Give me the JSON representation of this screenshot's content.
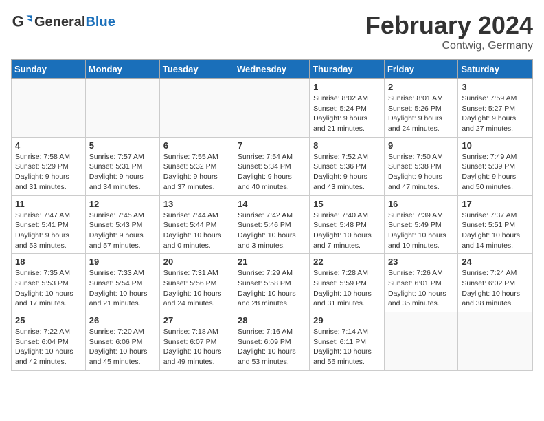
{
  "header": {
    "logo_general": "General",
    "logo_blue": "Blue",
    "month": "February 2024",
    "location": "Contwig, Germany"
  },
  "days_of_week": [
    "Sunday",
    "Monday",
    "Tuesday",
    "Wednesday",
    "Thursday",
    "Friday",
    "Saturday"
  ],
  "weeks": [
    [
      {
        "day": "",
        "content": ""
      },
      {
        "day": "",
        "content": ""
      },
      {
        "day": "",
        "content": ""
      },
      {
        "day": "",
        "content": ""
      },
      {
        "day": "1",
        "content": "Sunrise: 8:02 AM\nSunset: 5:24 PM\nDaylight: 9 hours\nand 21 minutes."
      },
      {
        "day": "2",
        "content": "Sunrise: 8:01 AM\nSunset: 5:26 PM\nDaylight: 9 hours\nand 24 minutes."
      },
      {
        "day": "3",
        "content": "Sunrise: 7:59 AM\nSunset: 5:27 PM\nDaylight: 9 hours\nand 27 minutes."
      }
    ],
    [
      {
        "day": "4",
        "content": "Sunrise: 7:58 AM\nSunset: 5:29 PM\nDaylight: 9 hours\nand 31 minutes."
      },
      {
        "day": "5",
        "content": "Sunrise: 7:57 AM\nSunset: 5:31 PM\nDaylight: 9 hours\nand 34 minutes."
      },
      {
        "day": "6",
        "content": "Sunrise: 7:55 AM\nSunset: 5:32 PM\nDaylight: 9 hours\nand 37 minutes."
      },
      {
        "day": "7",
        "content": "Sunrise: 7:54 AM\nSunset: 5:34 PM\nDaylight: 9 hours\nand 40 minutes."
      },
      {
        "day": "8",
        "content": "Sunrise: 7:52 AM\nSunset: 5:36 PM\nDaylight: 9 hours\nand 43 minutes."
      },
      {
        "day": "9",
        "content": "Sunrise: 7:50 AM\nSunset: 5:38 PM\nDaylight: 9 hours\nand 47 minutes."
      },
      {
        "day": "10",
        "content": "Sunrise: 7:49 AM\nSunset: 5:39 PM\nDaylight: 9 hours\nand 50 minutes."
      }
    ],
    [
      {
        "day": "11",
        "content": "Sunrise: 7:47 AM\nSunset: 5:41 PM\nDaylight: 9 hours\nand 53 minutes."
      },
      {
        "day": "12",
        "content": "Sunrise: 7:45 AM\nSunset: 5:43 PM\nDaylight: 9 hours\nand 57 minutes."
      },
      {
        "day": "13",
        "content": "Sunrise: 7:44 AM\nSunset: 5:44 PM\nDaylight: 10 hours\nand 0 minutes."
      },
      {
        "day": "14",
        "content": "Sunrise: 7:42 AM\nSunset: 5:46 PM\nDaylight: 10 hours\nand 3 minutes."
      },
      {
        "day": "15",
        "content": "Sunrise: 7:40 AM\nSunset: 5:48 PM\nDaylight: 10 hours\nand 7 minutes."
      },
      {
        "day": "16",
        "content": "Sunrise: 7:39 AM\nSunset: 5:49 PM\nDaylight: 10 hours\nand 10 minutes."
      },
      {
        "day": "17",
        "content": "Sunrise: 7:37 AM\nSunset: 5:51 PM\nDaylight: 10 hours\nand 14 minutes."
      }
    ],
    [
      {
        "day": "18",
        "content": "Sunrise: 7:35 AM\nSunset: 5:53 PM\nDaylight: 10 hours\nand 17 minutes."
      },
      {
        "day": "19",
        "content": "Sunrise: 7:33 AM\nSunset: 5:54 PM\nDaylight: 10 hours\nand 21 minutes."
      },
      {
        "day": "20",
        "content": "Sunrise: 7:31 AM\nSunset: 5:56 PM\nDaylight: 10 hours\nand 24 minutes."
      },
      {
        "day": "21",
        "content": "Sunrise: 7:29 AM\nSunset: 5:58 PM\nDaylight: 10 hours\nand 28 minutes."
      },
      {
        "day": "22",
        "content": "Sunrise: 7:28 AM\nSunset: 5:59 PM\nDaylight: 10 hours\nand 31 minutes."
      },
      {
        "day": "23",
        "content": "Sunrise: 7:26 AM\nSunset: 6:01 PM\nDaylight: 10 hours\nand 35 minutes."
      },
      {
        "day": "24",
        "content": "Sunrise: 7:24 AM\nSunset: 6:02 PM\nDaylight: 10 hours\nand 38 minutes."
      }
    ],
    [
      {
        "day": "25",
        "content": "Sunrise: 7:22 AM\nSunset: 6:04 PM\nDaylight: 10 hours\nand 42 minutes."
      },
      {
        "day": "26",
        "content": "Sunrise: 7:20 AM\nSunset: 6:06 PM\nDaylight: 10 hours\nand 45 minutes."
      },
      {
        "day": "27",
        "content": "Sunrise: 7:18 AM\nSunset: 6:07 PM\nDaylight: 10 hours\nand 49 minutes."
      },
      {
        "day": "28",
        "content": "Sunrise: 7:16 AM\nSunset: 6:09 PM\nDaylight: 10 hours\nand 53 minutes."
      },
      {
        "day": "29",
        "content": "Sunrise: 7:14 AM\nSunset: 6:11 PM\nDaylight: 10 hours\nand 56 minutes."
      },
      {
        "day": "",
        "content": ""
      },
      {
        "day": "",
        "content": ""
      }
    ]
  ]
}
